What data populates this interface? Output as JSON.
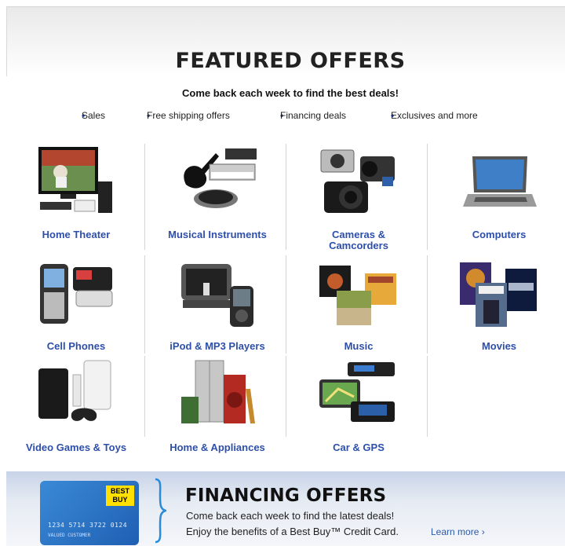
{
  "header": {
    "title": "FEATURED OFFERS",
    "subtitle": "Come back each week to find the best deals!",
    "bullets": [
      "Sales",
      "Free shipping offers",
      "Financing deals",
      "Exclusives and more"
    ]
  },
  "categories": {
    "home_theater": "Home Theater",
    "musical_instruments": "Musical Instruments",
    "cameras_line1": "Cameras &",
    "cameras_line2": "Camcorders",
    "computers": "Computers",
    "cell_phones": "Cell Phones",
    "ipod": "iPod & MP3 Players",
    "music": "Music",
    "movies": "Movies",
    "video_games": "Video Games & Toys",
    "home_appliances": "Home & Appliances",
    "car_gps": "Car & GPS"
  },
  "financing": {
    "title": "FINANCING OFFERS",
    "line1": "Come back each week to find the latest deals!",
    "line2": "Enjoy the benefits of a Best Buy™ Credit Card.",
    "learn_more": "Learn more ›",
    "card_logo": "BEST BUY",
    "card_number": "1234 5714 3722 0124",
    "card_name": "VALUED CUSTOMER"
  },
  "colors": {
    "link": "#2d4faa",
    "card_blue": "#1f5fb3",
    "card_logo_yellow": "#ffe000",
    "brace_blue": "#2a8bd8"
  }
}
